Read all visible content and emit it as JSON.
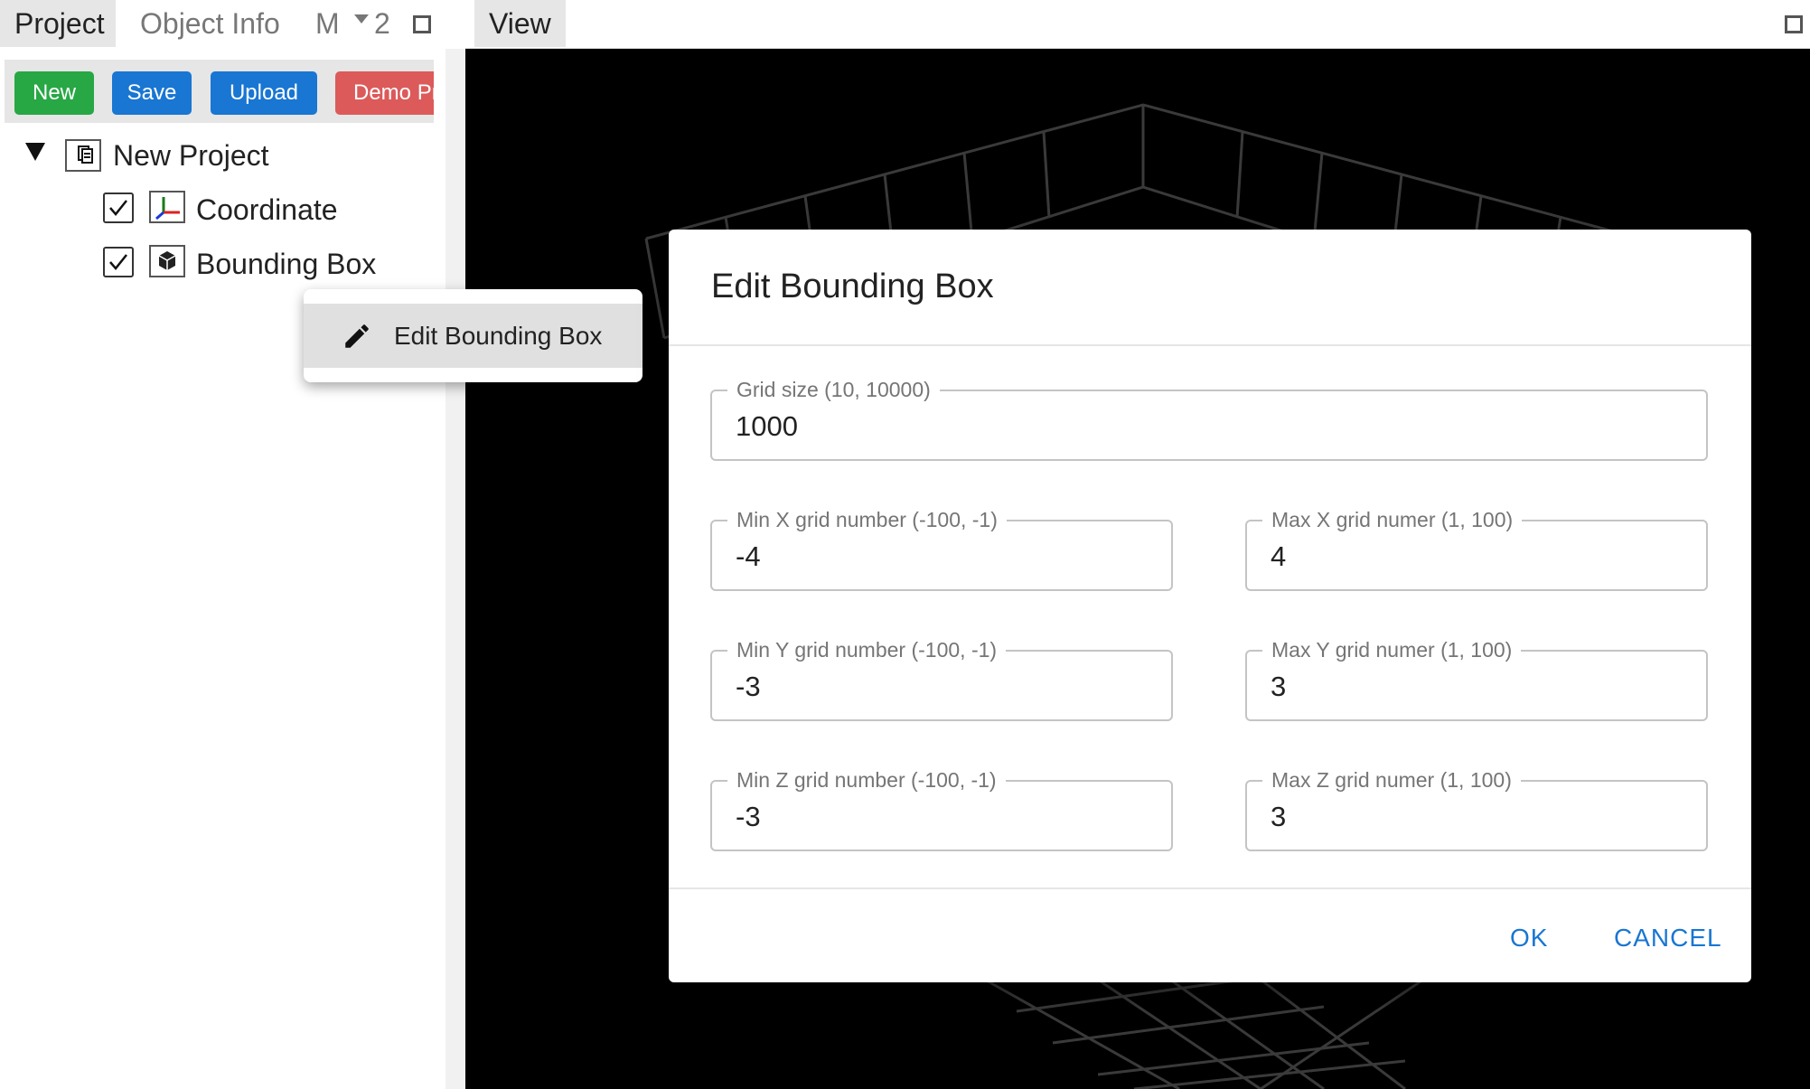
{
  "tabs": {
    "project": "Project",
    "object_info": "Object Info",
    "more": "M",
    "count": "2"
  },
  "toolbar": {
    "new_label": "New",
    "save_label": "Save",
    "upload_label": "Upload",
    "demo_label": "Demo Pro"
  },
  "tree": {
    "root_label": "New Project",
    "items": [
      {
        "label": "Coordinate",
        "checked": true
      },
      {
        "label": "Bounding Box",
        "checked": true
      }
    ]
  },
  "view": {
    "tab_label": "View"
  },
  "context_menu": {
    "edit_label": "Edit Bounding Box"
  },
  "dialog": {
    "title": "Edit Bounding Box",
    "grid_size": {
      "label": "Grid size (10, 10000)",
      "value": "1000"
    },
    "min_x": {
      "label": "Min X grid number (-100, -1)",
      "value": "-4"
    },
    "max_x": {
      "label": "Max X grid numer (1, 100)",
      "value": "4"
    },
    "min_y": {
      "label": "Min Y grid number (-100, -1)",
      "value": "-3"
    },
    "max_y": {
      "label": "Max Y grid numer (1, 100)",
      "value": "3"
    },
    "min_z": {
      "label": "Min Z grid number (-100, -1)",
      "value": "-3"
    },
    "max_z": {
      "label": "Max Z grid numer (1, 100)",
      "value": "3"
    },
    "ok_label": "OK",
    "cancel_label": "CANCEL"
  },
  "colors": {
    "new_button": "#28a745",
    "primary": "#1976d2",
    "demo_button": "#dc5a5a",
    "viewport_bg": "#000000",
    "grid_lines": "#3a3a3a"
  },
  "icons": {
    "expand": "expand-icon",
    "project": "project-icon",
    "coordinate": "coordinate-axes-icon",
    "bounding_box": "cube-icon",
    "pencil": "pencil-icon"
  }
}
